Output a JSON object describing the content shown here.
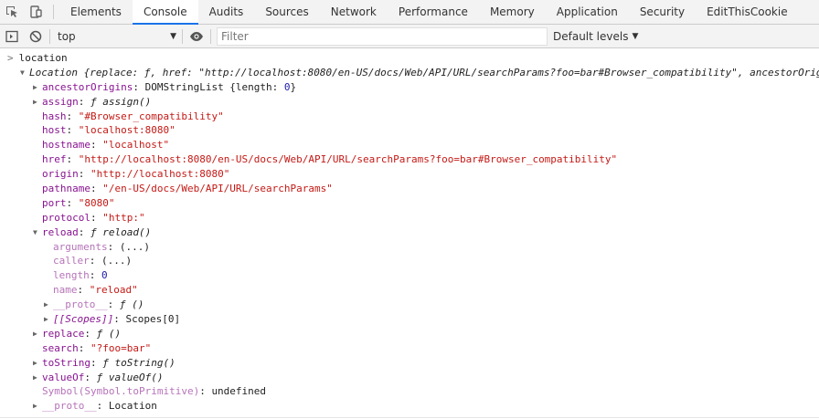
{
  "tabs": [
    "Elements",
    "Console",
    "Audits",
    "Sources",
    "Network",
    "Performance",
    "Memory",
    "Application",
    "Security",
    "EditThisCookie"
  ],
  "active_tab": "Console",
  "toolbar": {
    "context": "top",
    "filter_placeholder": "Filter",
    "levels": "Default levels"
  },
  "console": {
    "prompt": "location",
    "result_header": "Location {replace: ƒ, href: \"http://localhost:8080/en-US/docs/Web/API/URL/searchParams?foo=bar#Browser_compatibility\", ancestorOrigins: DOMStringList, assign: ƒ, hash: \"#Browser_compatibility\", …}",
    "props": {
      "ancestorOrigins": {
        "key": "ancestorOrigins",
        "value": "DOMStringList {length: ",
        "num": "0",
        "tail": "}"
      },
      "assign": {
        "key": "assign",
        "value": "ƒ assign()"
      },
      "hash": {
        "key": "hash",
        "value": "\"#Browser_compatibility\""
      },
      "host": {
        "key": "host",
        "value": "\"localhost:8080\""
      },
      "hostname": {
        "key": "hostname",
        "value": "\"localhost\""
      },
      "href": {
        "key": "href",
        "value": "\"http://localhost:8080/en-US/docs/Web/API/URL/searchParams?foo=bar#Browser_compatibility\""
      },
      "origin": {
        "key": "origin",
        "value": "\"http://localhost:8080\""
      },
      "pathname": {
        "key": "pathname",
        "value": "\"/en-US/docs/Web/API/URL/searchParams\""
      },
      "port": {
        "key": "port",
        "value": "\"8080\""
      },
      "protocol": {
        "key": "protocol",
        "value": "\"http:\""
      },
      "reload": {
        "key": "reload",
        "value": "ƒ reload()"
      },
      "arguments": {
        "key": "arguments",
        "value": "(...)"
      },
      "caller": {
        "key": "caller",
        "value": "(...)"
      },
      "length": {
        "key": "length",
        "value": "0"
      },
      "name": {
        "key": "name",
        "value": "\"reload\""
      },
      "reload_proto": {
        "key": "__proto__",
        "value": "ƒ ()"
      },
      "scopes": {
        "key": "[[Scopes]]",
        "value": "Scopes[0]"
      },
      "replace": {
        "key": "replace",
        "value": "ƒ ()"
      },
      "search": {
        "key": "search",
        "value": "\"?foo=bar\""
      },
      "toString": {
        "key": "toString",
        "value": "ƒ toString()"
      },
      "valueOf": {
        "key": "valueOf",
        "value": "ƒ valueOf()"
      },
      "symbol": {
        "key": "Symbol(Symbol.toPrimitive)",
        "value": "undefined"
      },
      "proto": {
        "key": "__proto__",
        "value": "Location"
      }
    }
  }
}
